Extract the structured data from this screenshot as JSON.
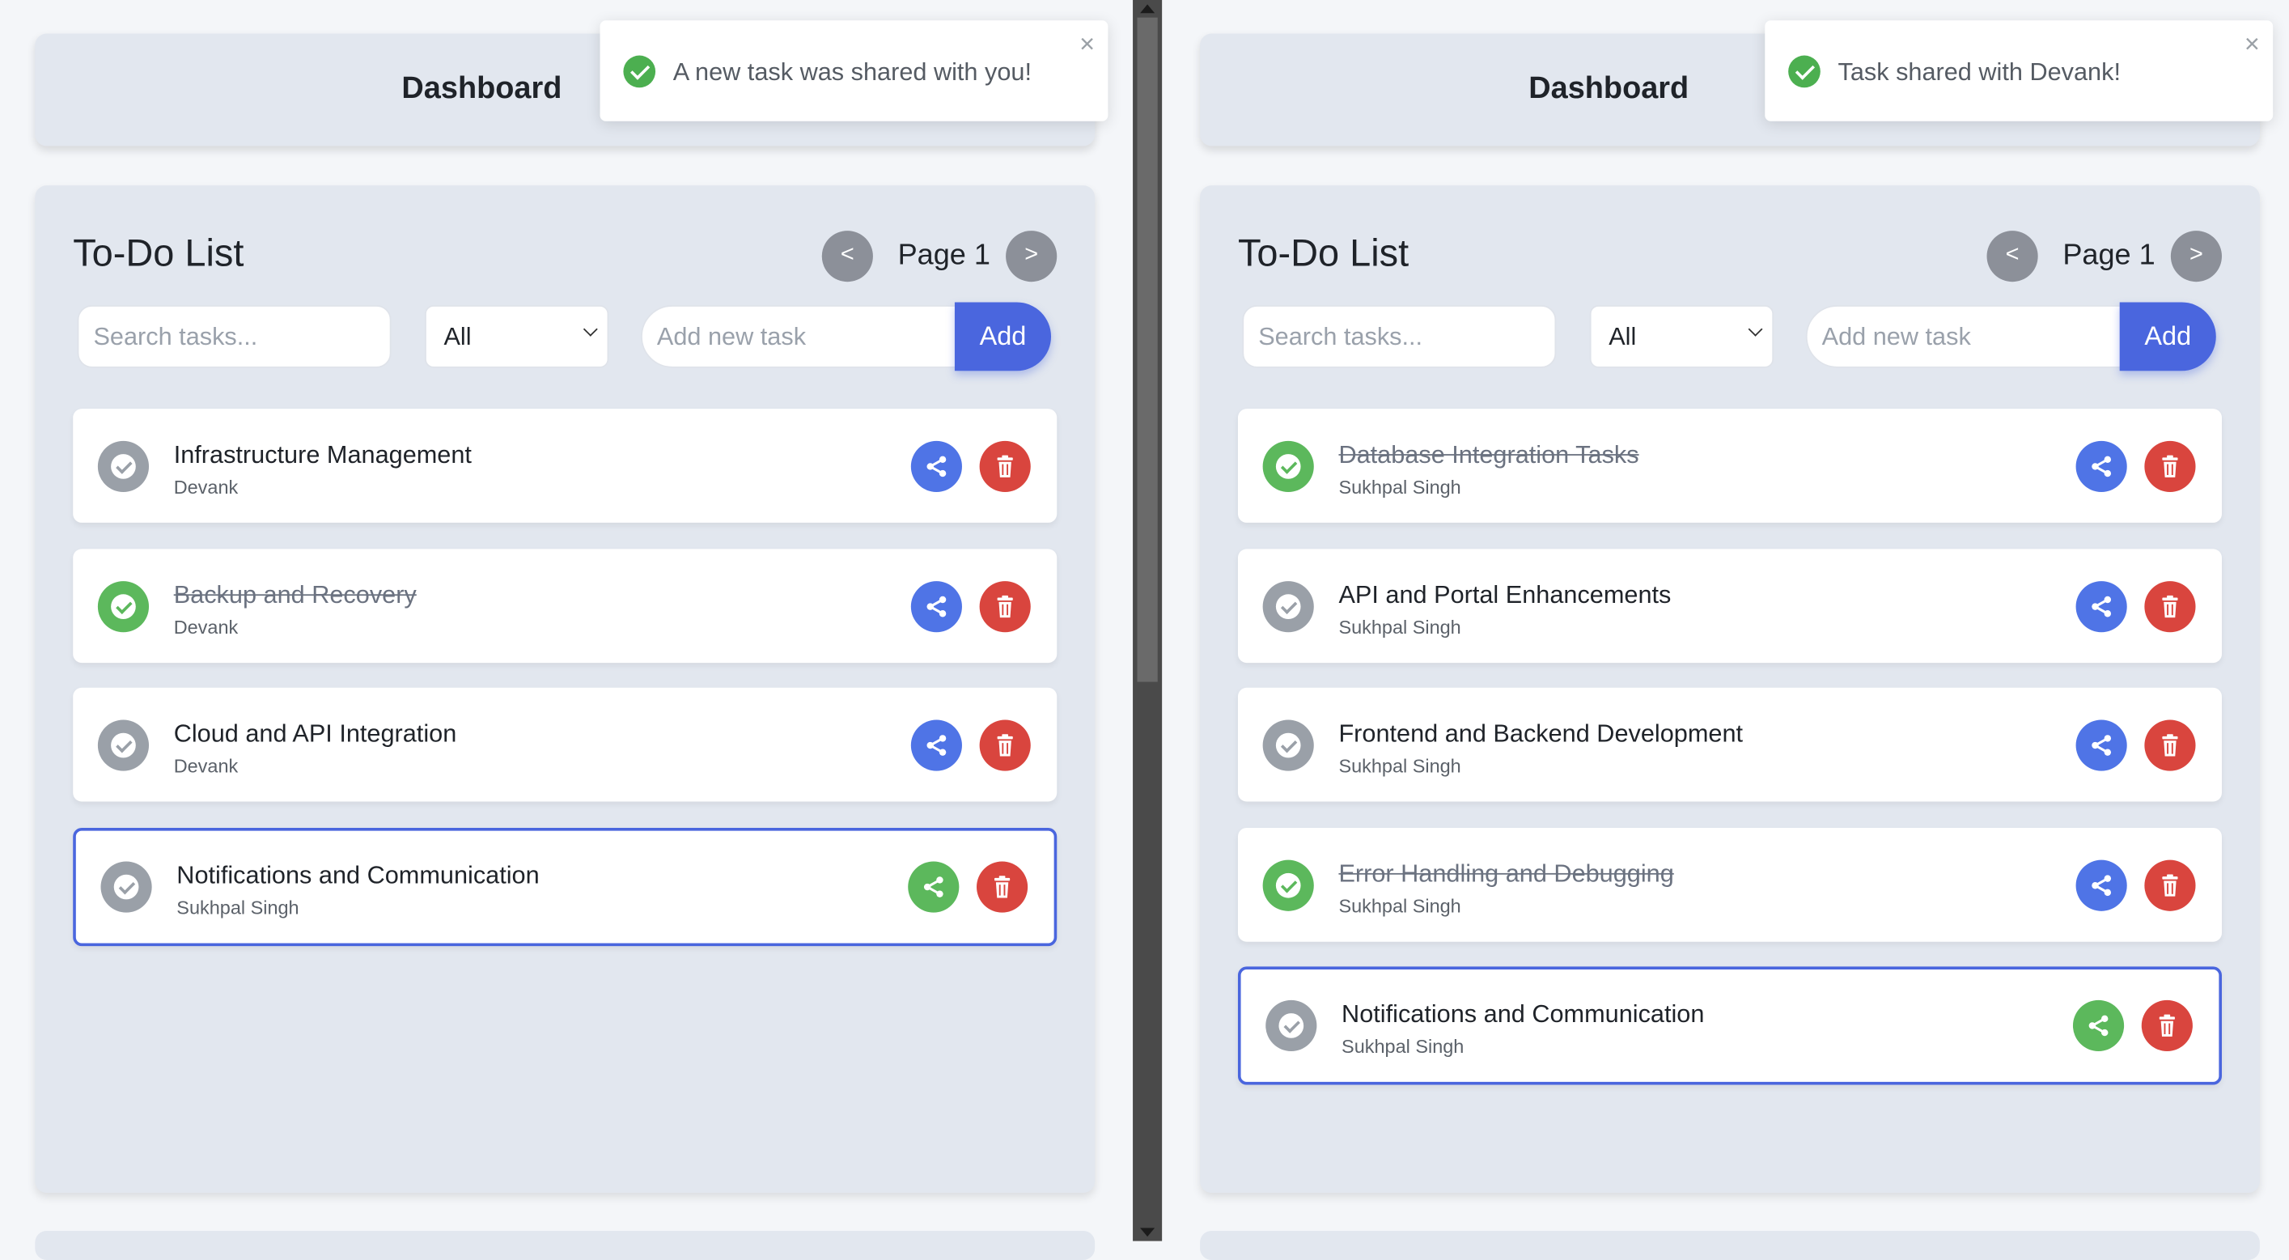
{
  "left": {
    "header": {
      "title": "Dashboard"
    },
    "toast": {
      "message": "A new task was shared with you!",
      "close": "×"
    },
    "todo": {
      "title": "To-Do List",
      "pager": {
        "prev": "<",
        "page": "Page 1",
        "next": ">"
      },
      "search_placeholder": "Search tasks...",
      "filter_value": "All",
      "add_placeholder": "Add new task",
      "add_label": "Add",
      "tasks": [
        {
          "title": "Infrastructure Management",
          "owner": "Devank",
          "completed": false,
          "shared": false
        },
        {
          "title": "Backup and Recovery",
          "owner": "Devank",
          "completed": true,
          "shared": false
        },
        {
          "title": "Cloud and API Integration",
          "owner": "Devank",
          "completed": false,
          "shared": false
        },
        {
          "title": "Notifications and Communication",
          "owner": "Sukhpal Singh",
          "completed": false,
          "shared": true
        }
      ]
    }
  },
  "right": {
    "header": {
      "title": "Dashboard"
    },
    "toast": {
      "message": "Task shared with Devank!",
      "close": "×"
    },
    "todo": {
      "title": "To-Do List",
      "pager": {
        "prev": "<",
        "page": "Page 1",
        "next": ">"
      },
      "search_placeholder": "Search tasks...",
      "filter_value": "All",
      "add_placeholder": "Add new task",
      "add_label": "Add",
      "tasks": [
        {
          "title": "Database Integration Tasks",
          "owner": "Sukhpal Singh",
          "completed": true,
          "shared": false
        },
        {
          "title": "API and Portal Enhancements",
          "owner": "Sukhpal Singh",
          "completed": false,
          "shared": false
        },
        {
          "title": "Frontend and Backend Development",
          "owner": "Sukhpal Singh",
          "completed": false,
          "shared": false
        },
        {
          "title": "Error Handling and Debugging",
          "owner": "Sukhpal Singh",
          "completed": true,
          "shared": false
        },
        {
          "title": "Notifications and Communication",
          "owner": "Sukhpal Singh",
          "completed": false,
          "shared": true
        }
      ]
    }
  },
  "colors": {
    "accent": "#4a66de",
    "share": "#4f74e6",
    "shared": "#5cb85c",
    "delete": "#d9453e",
    "complete": "#5cb85c",
    "pending": "#9aa0a8"
  },
  "icons": [
    "check-circle-icon",
    "close-icon",
    "share-icon",
    "trash-icon",
    "chevron-down-icon"
  ]
}
